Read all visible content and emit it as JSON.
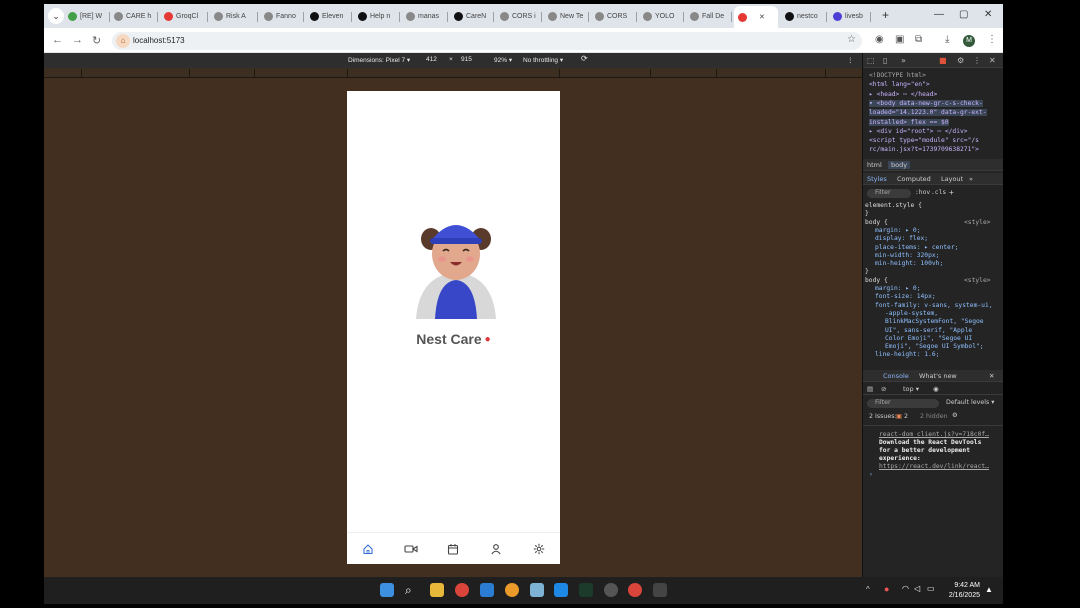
{
  "tabs": [
    {
      "label": "[RE] W",
      "color": "#43a047"
    },
    {
      "label": "CARE h",
      "color": "#888888"
    },
    {
      "label": "GroqCl",
      "color": "#e53935"
    },
    {
      "label": "Risk A",
      "color": "#888888"
    },
    {
      "label": "Fanno",
      "color": "#888888"
    },
    {
      "label": "Eleven",
      "color": "#111111"
    },
    {
      "label": "Help n",
      "color": "#111111"
    },
    {
      "label": "manas",
      "color": "#888888"
    },
    {
      "label": "CareN",
      "color": "#111111"
    },
    {
      "label": "CORS i",
      "color": "#888888"
    },
    {
      "label": "New Te",
      "color": "#888888"
    },
    {
      "label": "CORS",
      "color": "#888888"
    },
    {
      "label": "YOLO",
      "color": "#888888"
    },
    {
      "label": "Fall De",
      "color": "#888888"
    },
    {
      "label": "",
      "color": "#e53935",
      "active": true
    },
    {
      "label": "nestco",
      "color": "#111111"
    },
    {
      "label": "livesb",
      "color": "#4b3fd6"
    }
  ],
  "address": {
    "url": "localhost:5173"
  },
  "profile": {
    "initial": "M"
  },
  "device_toolbar": {
    "dimensions": "Dimensions: Pixel 7 ▾",
    "width": "412",
    "times": "×",
    "height": "915",
    "zoom": "92% ▾",
    "throttling": "No throttling ▾"
  },
  "app": {
    "name": "Nest Care",
    "nav": [
      "home-icon",
      "video-icon",
      "calendar-icon",
      "user-icon",
      "settings-icon"
    ],
    "accent": "#e0353a"
  },
  "devtools": {
    "elements": [
      "<!DOCTYPE html>",
      "<html lang=\"en\">",
      "▸ <head> ⋯ </head>",
      "▾ <body data-new-gr-c-s-check-",
      "loaded=\"14.1223.0\" data-gr-ext-",
      "installed> flex == $0",
      "▸ <div id=\"root\"> ⋯ </div>",
      "<script type=\"module\" src=\"/s",
      "rc/main.jsx?t=1739709638271\">"
    ],
    "crumbs": [
      "html",
      "body"
    ],
    "style_tabs": [
      "Styles",
      "Computed",
      "Layout",
      "»"
    ],
    "filter": "Filter",
    "hov": ":hov",
    "cls": ".cls",
    "rules": [
      "element.style {",
      "}",
      "body {",
      "margin: ▸ 0;",
      "display: flex;",
      "place-items: ▸ center;",
      "min-width: 320px;",
      "min-height: 100vh;",
      "}",
      "body {",
      "margin: ▸ 0;",
      "font-size: 14px;",
      "font-family: v-sans, system-ui,",
      "-apple-system,",
      "BlinkMacSystemFont, \"Segoe",
      "UI\", sans-serif, \"Apple",
      "Color Emoji\", \"Segoe UI",
      "Emoji\", \"Segoe UI Symbol\";",
      "line-height: 1.6;"
    ],
    "style_source": "<style>",
    "console_tabs": [
      "Console",
      "What's new"
    ],
    "context": "top ▾",
    "levels": "Default levels ▾",
    "issues": "2 Issues:",
    "issue_count": "2",
    "hidden": "2 hidden",
    "log_source": "react-dom_client.js?v=718c0f…",
    "log_text": [
      "Download the React DevTools",
      "for a better development",
      "experience:"
    ],
    "log_link": "https://react.dev/link/react…",
    "prompt": "›"
  },
  "taskbar": {
    "time": "9:42 AM",
    "date": "2/16/2025"
  }
}
